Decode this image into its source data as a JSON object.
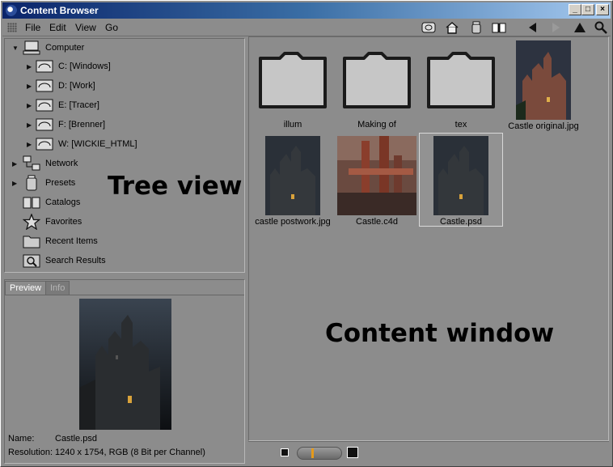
{
  "window": {
    "title": "Content Browser"
  },
  "title_buttons": {
    "minimize": "_",
    "maximize": "□",
    "close": "×"
  },
  "menu": [
    "File",
    "Edit",
    "View",
    "Go"
  ],
  "toolbar_icons": [
    "sync-icon",
    "home-icon",
    "presets-icon",
    "catalog-book-icon",
    "back-arrow-icon",
    "forward-arrow-icon",
    "up-arrow-icon",
    "search-icon"
  ],
  "tree": {
    "items": [
      {
        "label": "Computer",
        "icon": "computer-icon",
        "expanded": true
      },
      {
        "label": "C: [Windows]",
        "icon": "drive-icon"
      },
      {
        "label": "D: [Work]",
        "icon": "drive-icon"
      },
      {
        "label": "E: [Tracer]",
        "icon": "drive-icon"
      },
      {
        "label": "F: [Brenner]",
        "icon": "drive-icon"
      },
      {
        "label": "W: [WICKIE_HTML]",
        "icon": "drive-icon"
      },
      {
        "label": "Network",
        "icon": "network-icon"
      },
      {
        "label": "Presets",
        "icon": "presets-icon"
      },
      {
        "label": "Catalogs",
        "icon": "catalog-book-icon"
      },
      {
        "label": "Favorites",
        "icon": "star-icon"
      },
      {
        "label": "Recent Items",
        "icon": "folder-icon"
      },
      {
        "label": "Search Results",
        "icon": "search-results-icon"
      }
    ],
    "overlay_label": "Tree view"
  },
  "preview": {
    "tabs": [
      "Preview",
      "Info"
    ],
    "name_label": "Name:",
    "name_value": "Castle.psd",
    "resolution_label": "Resolution:",
    "resolution_value": "1240 x 1754, RGB (8 Bit per Channel)"
  },
  "content": {
    "overlay_label": "Content window",
    "items": [
      {
        "caption": "illum",
        "kind": "folder"
      },
      {
        "caption": "Making of",
        "kind": "folder"
      },
      {
        "caption": "tex",
        "kind": "folder"
      },
      {
        "caption": "Castle original.jpg",
        "kind": "image"
      },
      {
        "caption": "castle postwork.jpg",
        "kind": "image"
      },
      {
        "caption": "Castle.c4d",
        "kind": "image"
      },
      {
        "caption": "Castle.psd",
        "kind": "image",
        "selected": true
      }
    ]
  },
  "statusbar": {
    "thumbnail_size_level": 0.3
  }
}
